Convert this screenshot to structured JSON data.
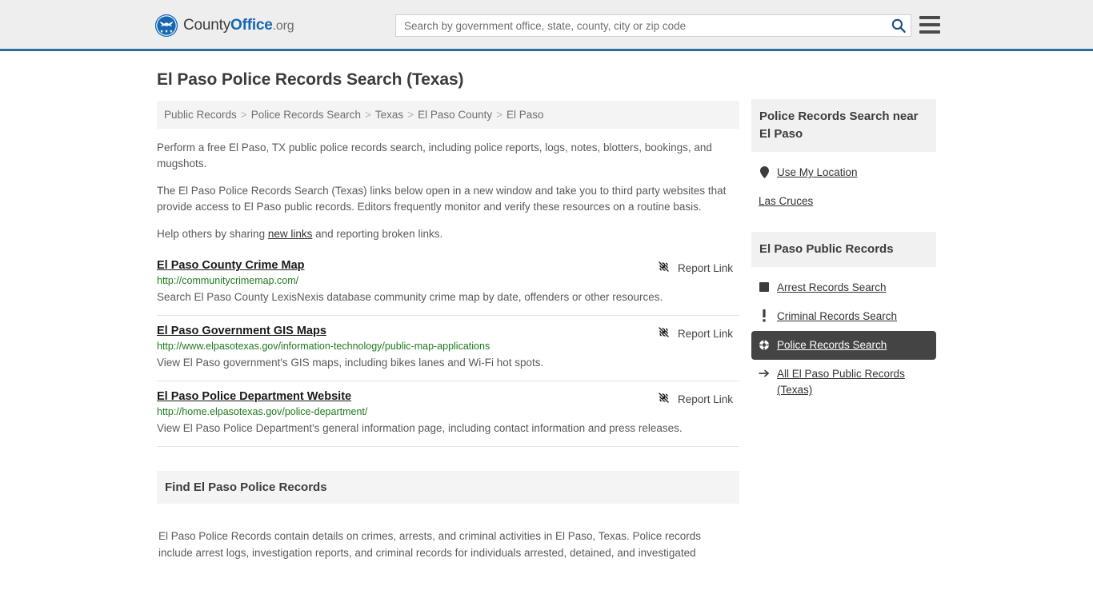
{
  "header": {
    "brand_county": "County",
    "brand_office": "Office",
    "brand_tld": ".org",
    "logo_icon": "eagle-seal-logo",
    "search_placeholder": "Search by government office, state, county, city or zip code",
    "search_value": "",
    "search_icon": "search-icon",
    "menu_icon": "hamburger-menu-icon",
    "accent_color": "#2e6da4"
  },
  "main": {
    "page_title": "El Paso Police Records Search (Texas)",
    "breadcrumb": [
      "Public Records",
      "Police Records Search",
      "Texas",
      "El Paso County",
      "El Paso"
    ],
    "breadcrumb_separator": ">",
    "intro_paragraph_1": "Perform a free El Paso, TX public police records search, including police reports, logs, notes, blotters, bookings, and mugshots.",
    "intro_paragraph_2": "The El Paso Police Records Search (Texas) links below open in a new window and take you to third party websites that provide access to El Paso public records. Editors frequently monitor and verify these resources on a routine basis.",
    "help_prefix": "Help others by sharing ",
    "help_link": "new links",
    "help_suffix": " and reporting broken links.",
    "report_link_label": "Report Link",
    "report_link_icon": "broken-link-icon",
    "results": [
      {
        "title": "El Paso County Crime Map",
        "url": "http://communitycrimemap.com/",
        "description": "Search El Paso County LexisNexis database community crime map by date, offenders or other resources."
      },
      {
        "title": "El Paso Government GIS Maps",
        "url": "http://www.elpasotexas.gov/information-technology/public-map-applications",
        "description": "View El Paso government's GIS maps, including bikes lanes and Wi-Fi hot spots."
      },
      {
        "title": "El Paso Police Department Website",
        "url": "http://home.elpasotexas.gov/police-department/",
        "description": "View El Paso Police Department's general information page, including contact information and press releases."
      }
    ],
    "find_section_title": "Find El Paso Police Records",
    "find_section_body": "El Paso Police Records contain details on crimes, arrests, and criminal activities in El Paso, Texas. Police records include arrest logs, investigation reports, and criminal records for individuals arrested, detained, and investigated"
  },
  "sidebar": {
    "near_box": {
      "title": "Police Records Search near El Paso",
      "items": [
        {
          "label": "Use My Location",
          "icon": "map-pin-icon"
        },
        {
          "label": "Las Cruces",
          "icon": "none"
        }
      ]
    },
    "records_box": {
      "title": "El Paso Public Records",
      "items": [
        {
          "label": "Arrest Records Search",
          "icon": "square-icon",
          "active": false
        },
        {
          "label": "Criminal Records Search",
          "icon": "exclamation-icon",
          "active": false
        },
        {
          "label": "Police Records Search",
          "icon": "target-crosshair-icon",
          "active": true
        },
        {
          "label": "All El Paso Public Records (Texas)",
          "icon": "arrow-right-icon",
          "active": false
        }
      ],
      "active_background": "#444444"
    }
  }
}
